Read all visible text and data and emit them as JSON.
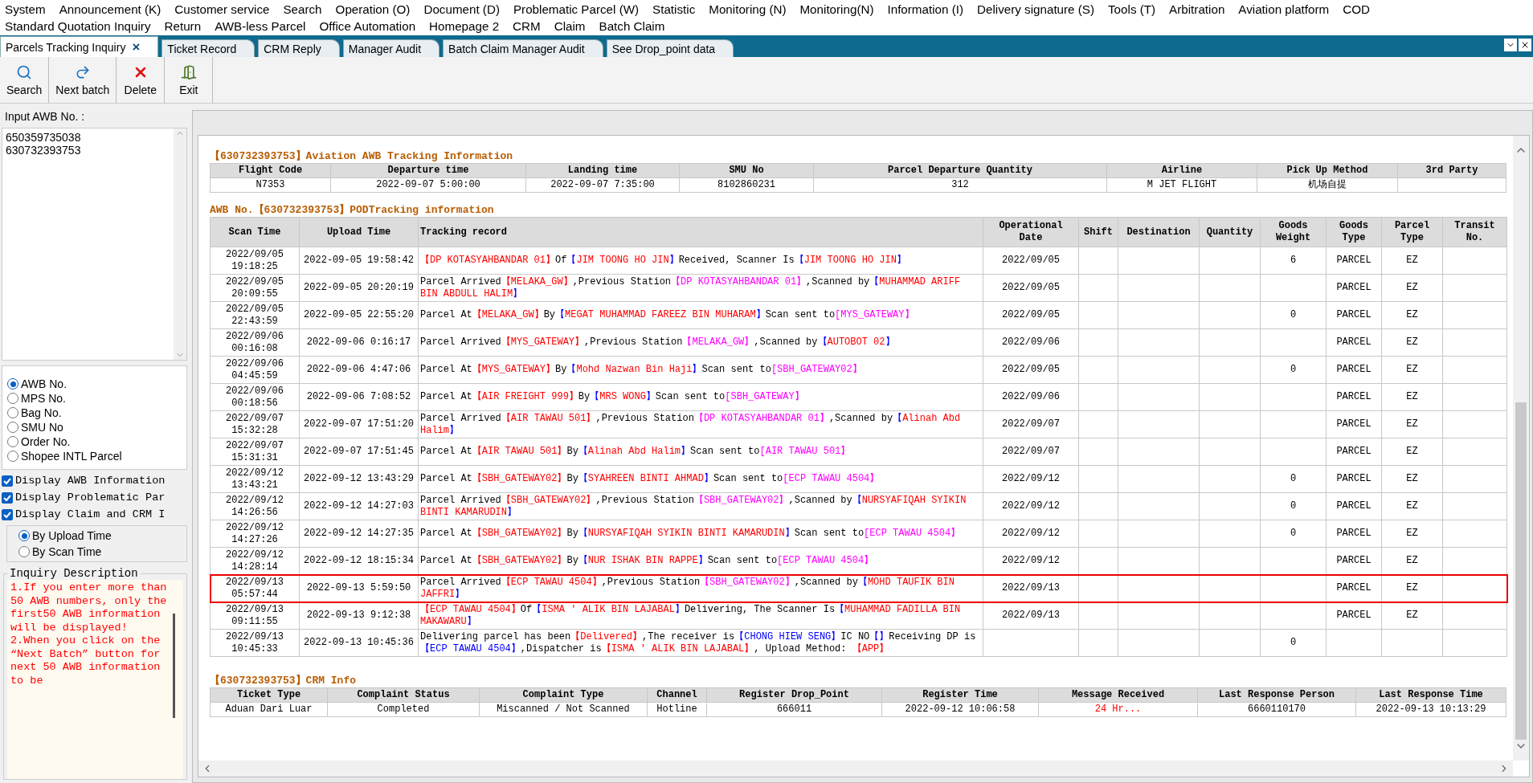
{
  "menu_bar": {
    "items": [
      "System",
      "Announcement (K)",
      "Customer service",
      "Search",
      "Operation (O)",
      "Document (D)",
      "Problematic Parcel (W)",
      "Statistic",
      "Monitoring (N)",
      "Monitoring(N)",
      "Information (I)",
      "Delivery signature (S)",
      "Tools (T)",
      "Arbitration",
      "Aviation platform",
      "COD",
      "Standard Quotation Inquiry",
      "Return",
      "AWB-less Parcel",
      "Office Automation",
      "Homepage 2",
      "CRM",
      "Claim",
      "Batch Claim"
    ]
  },
  "tabs": [
    {
      "label": "Parcels Tracking Inquiry",
      "selected": true,
      "close": "×"
    },
    {
      "label": "Ticket Record",
      "selected": false
    },
    {
      "label": "CRM Reply",
      "selected": false
    },
    {
      "label": "Manager Audit",
      "selected": false
    },
    {
      "label": "Batch Claim Manager Audit",
      "selected": false
    },
    {
      "label": "See Drop_point data",
      "selected": false
    }
  ],
  "toolbar": [
    {
      "label": "Search",
      "kind": "search"
    },
    {
      "label": "Next batch",
      "kind": "next"
    },
    {
      "label": "Delete",
      "kind": "delete"
    },
    {
      "label": "Exit",
      "kind": "exit"
    }
  ],
  "sidebar": {
    "input_label": "Input AWB No. :",
    "awb_numbers": [
      "650359735038",
      "630732393753"
    ],
    "search_types": [
      {
        "label": "AWB No.",
        "selected": true
      },
      {
        "label": "MPS No.",
        "selected": false
      },
      {
        "label": "Bag No.",
        "selected": false
      },
      {
        "label": "SMU No",
        "selected": false
      },
      {
        "label": "Order No.",
        "selected": false
      },
      {
        "label": "Shopee INTL Parcel",
        "selected": false
      }
    ],
    "options": [
      {
        "label": "Display AWB Information",
        "checked": true
      },
      {
        "label": "Display Problematic Par",
        "checked": true
      },
      {
        "label": "Display Claim and CRM I",
        "checked": true
      }
    ],
    "sort": [
      {
        "label": "By Upload Time",
        "selected": true
      },
      {
        "label": "By Scan Time",
        "selected": false
      }
    ],
    "description": {
      "title": "Inquiry Description",
      "paragraphs": [
        "1.If you enter more than  50  AWB numbers, only the first50  AWB information will be displayed!",
        "2.When you click on the “Next Batch” button for next  50 AWB information to be"
      ]
    }
  },
  "aviation": {
    "title": "【630732393753】Aviation AWB Tracking Information",
    "columns": [
      "Flight Code",
      "Departure time",
      "Landing time",
      "SMU No",
      "Parcel Departure Quantity",
      "Airline",
      "Pick Up Method",
      "3rd Party"
    ],
    "rows": [
      [
        "N7353",
        "2022-09-07 5:00:00",
        "2022-09-07 7:35:00",
        "8102860231",
        "312",
        "M JET FLIGHT",
        "机场自提",
        ""
      ]
    ]
  },
  "tracking": {
    "title": "AWB No.【630732393753】PODTracking information",
    "columns": [
      "Scan Time",
      "Upload Time",
      "Tracking record",
      "Operational Date",
      "Shift",
      "Destination",
      "Quantity",
      "Goods Weight",
      "Goods Type",
      "Parcel Type",
      "Transit No."
    ],
    "rows": [
      {
        "selected": false,
        "scan_time": "2022/09/05 19:18:25",
        "upload_time": "2022-09-05 19:58:42",
        "record": [
          {
            "kind": "site",
            "text": "【DP KOTASYAHBANDAR 01】"
          },
          {
            "kind": "text",
            "text": "Of"
          },
          {
            "kind": "person",
            "text": "【JIM TOONG HO JIN】"
          },
          {
            "kind": "text",
            "text": "Received, Scanner Is"
          },
          {
            "kind": "person",
            "text": "【JIM TOONG HO JIN】"
          }
        ],
        "operational_date": "2022/09/05",
        "goods_weight": "6",
        "goods_type": "PARCEL",
        "parcel_type": "EZ"
      },
      {
        "selected": false,
        "scan_time": "2022/09/05 20:09:55",
        "upload_time": "2022-09-05 20:20:19",
        "record": [
          {
            "kind": "text",
            "text": "Parcel Arrived"
          },
          {
            "kind": "site",
            "text": "【MELAKA_GW】"
          },
          {
            "kind": "text",
            "text": ",Previous Station"
          },
          {
            "kind": "next",
            "text": "【DP KOTASYAHBANDAR 01】"
          },
          {
            "kind": "text",
            "text": ",Scanned by"
          },
          {
            "kind": "person",
            "text": "【MUHAMMAD ARIFF BIN ABDULL HALIM】"
          }
        ],
        "operational_date": "2022/09/05",
        "goods_type": "PARCEL",
        "parcel_type": "EZ"
      },
      {
        "selected": false,
        "scan_time": "2022/09/05 22:43:59",
        "upload_time": "2022-09-05 22:55:20",
        "record": [
          {
            "kind": "text",
            "text": "Parcel At"
          },
          {
            "kind": "site",
            "text": "【MELAKA_GW】"
          },
          {
            "kind": "text",
            "text": "By"
          },
          {
            "kind": "person",
            "text": "【MEGAT MUHAMMAD FAREEZ BIN MUHARAM】"
          },
          {
            "kind": "text",
            "text": "Scan sent to"
          },
          {
            "kind": "next",
            "text": "[MYS_GATEWAY】"
          }
        ],
        "operational_date": "2022/09/05",
        "goods_weight": "0",
        "goods_type": "PARCEL",
        "parcel_type": "EZ"
      },
      {
        "selected": false,
        "scan_time": "2022/09/06 00:16:08",
        "upload_time": "2022-09-06 0:16:17",
        "record": [
          {
            "kind": "text",
            "text": "Parcel Arrived"
          },
          {
            "kind": "site",
            "text": "【MYS_GATEWAY】"
          },
          {
            "kind": "text",
            "text": ",Previous Station"
          },
          {
            "kind": "next",
            "text": "【MELAKA_GW】"
          },
          {
            "kind": "text",
            "text": ",Scanned by"
          },
          {
            "kind": "person",
            "text": "【AUTOBOT 02】"
          }
        ],
        "operational_date": "2022/09/06",
        "goods_type": "PARCEL",
        "parcel_type": "EZ"
      },
      {
        "selected": false,
        "scan_time": "2022/09/06 04:45:59",
        "upload_time": "2022-09-06 4:47:06",
        "record": [
          {
            "kind": "text",
            "text": "Parcel At"
          },
          {
            "kind": "site",
            "text": "【MYS_GATEWAY】"
          },
          {
            "kind": "text",
            "text": "By"
          },
          {
            "kind": "person",
            "text": "【Mohd Nazwan Bin Haji】"
          },
          {
            "kind": "text",
            "text": "Scan sent to"
          },
          {
            "kind": "next",
            "text": "[SBH_GATEWAY02】"
          }
        ],
        "operational_date": "2022/09/05",
        "goods_weight": "0",
        "goods_type": "PARCEL",
        "parcel_type": "EZ"
      },
      {
        "selected": false,
        "scan_time": "2022/09/06 00:18:56",
        "upload_time": "2022-09-06 7:08:52",
        "record": [
          {
            "kind": "text",
            "text": "Parcel At"
          },
          {
            "kind": "site",
            "text": "【AIR FREIGHT 999】"
          },
          {
            "kind": "text",
            "text": "By"
          },
          {
            "kind": "person",
            "text": "【MRS WONG】"
          },
          {
            "kind": "text",
            "text": "Scan sent to"
          },
          {
            "kind": "next",
            "text": "[SBH_GATEWAY】"
          }
        ],
        "operational_date": "2022/09/06",
        "goods_type": "PARCEL",
        "parcel_type": "EZ"
      },
      {
        "selected": false,
        "scan_time": "2022/09/07 15:32:28",
        "upload_time": "2022-09-07 17:51:20",
        "record": [
          {
            "kind": "text",
            "text": "Parcel Arrived"
          },
          {
            "kind": "site",
            "text": "【AIR TAWAU 501】"
          },
          {
            "kind": "text",
            "text": ",Previous Station"
          },
          {
            "kind": "next",
            "text": "【DP KOTASYAHBANDAR 01】"
          },
          {
            "kind": "text",
            "text": ",Scanned by"
          },
          {
            "kind": "person",
            "text": "【Alinah Abd Halim】"
          }
        ],
        "operational_date": "2022/09/07",
        "goods_type": "PARCEL",
        "parcel_type": "EZ"
      },
      {
        "selected": false,
        "scan_time": "2022/09/07 15:31:31",
        "upload_time": "2022-09-07 17:51:45",
        "record": [
          {
            "kind": "text",
            "text": "Parcel At"
          },
          {
            "kind": "site",
            "text": "【AIR TAWAU 501】"
          },
          {
            "kind": "text",
            "text": "By"
          },
          {
            "kind": "person",
            "text": "【Alinah Abd Halim】"
          },
          {
            "kind": "text",
            "text": "Scan sent to"
          },
          {
            "kind": "next",
            "text": "[AIR TAWAU 501】"
          }
        ],
        "operational_date": "2022/09/07",
        "goods_type": "PARCEL",
        "parcel_type": "EZ"
      },
      {
        "selected": false,
        "scan_time": "2022/09/12 13:43:21",
        "upload_time": "2022-09-12 13:43:29",
        "record": [
          {
            "kind": "text",
            "text": "Parcel At"
          },
          {
            "kind": "site",
            "text": "【SBH_GATEWAY02】"
          },
          {
            "kind": "text",
            "text": "By"
          },
          {
            "kind": "person",
            "text": "【SYAHREEN BINTI AHMAD】"
          },
          {
            "kind": "text",
            "text": "Scan sent to"
          },
          {
            "kind": "next",
            "text": "[ECP TAWAU 4504】"
          }
        ],
        "operational_date": "2022/09/12",
        "goods_weight": "0",
        "goods_type": "PARCEL",
        "parcel_type": "EZ"
      },
      {
        "selected": false,
        "scan_time": "2022/09/12 14:26:56",
        "upload_time": "2022-09-12 14:27:03",
        "record": [
          {
            "kind": "text",
            "text": "Parcel Arrived"
          },
          {
            "kind": "site",
            "text": "【SBH_GATEWAY02】"
          },
          {
            "kind": "text",
            "text": ",Previous Station"
          },
          {
            "kind": "next",
            "text": "【SBH_GATEWAY02】"
          },
          {
            "kind": "text",
            "text": ",Scanned by"
          },
          {
            "kind": "person",
            "text": "【NURSYAFIQAH SYIKIN BINTI KAMARUDIN】"
          }
        ],
        "operational_date": "2022/09/12",
        "goods_weight": "0",
        "goods_type": "PARCEL",
        "parcel_type": "EZ"
      },
      {
        "selected": false,
        "scan_time": "2022/09/12 14:27:26",
        "upload_time": "2022-09-12 14:27:35",
        "record": [
          {
            "kind": "text",
            "text": "Parcel At"
          },
          {
            "kind": "site",
            "text": "【SBH_GATEWAY02】"
          },
          {
            "kind": "text",
            "text": "By"
          },
          {
            "kind": "person",
            "text": "【NURSYAFIQAH SYIKIN BINTI KAMARUDIN】"
          },
          {
            "kind": "text",
            "text": "Scan sent to"
          },
          {
            "kind": "next",
            "text": "[ECP TAWAU 4504】"
          }
        ],
        "operational_date": "2022/09/12",
        "goods_weight": "0",
        "goods_type": "PARCEL",
        "parcel_type": "EZ"
      },
      {
        "selected": false,
        "scan_time": "2022/09/12 14:28:14",
        "upload_time": "2022-09-12 18:15:34",
        "record": [
          {
            "kind": "text",
            "text": "Parcel At"
          },
          {
            "kind": "site",
            "text": "【SBH_GATEWAY02】"
          },
          {
            "kind": "text",
            "text": "By"
          },
          {
            "kind": "person",
            "text": "【NUR ISHAK BIN RAPPE】"
          },
          {
            "kind": "text",
            "text": "Scan sent to"
          },
          {
            "kind": "next",
            "text": "[ECP TAWAU 4504】"
          }
        ],
        "operational_date": "2022/09/12",
        "goods_type": "PARCEL",
        "parcel_type": "EZ"
      },
      {
        "selected": true,
        "scan_time": "2022/09/13 05:57:44",
        "upload_time": "2022-09-13 5:59:50",
        "record": [
          {
            "kind": "text",
            "text": "Parcel Arrived"
          },
          {
            "kind": "site",
            "text": "【ECP TAWAU 4504】"
          },
          {
            "kind": "text",
            "text": ",Previous Station"
          },
          {
            "kind": "next",
            "text": "【SBH_GATEWAY02】"
          },
          {
            "kind": "text",
            "text": ",Scanned by"
          },
          {
            "kind": "person",
            "text": "【MOHD TAUFIK BIN JAFFRI】"
          }
        ],
        "operational_date": "2022/09/13",
        "goods_type": "PARCEL",
        "parcel_type": "EZ"
      },
      {
        "selected": false,
        "scan_time": "2022/09/13 09:11:55",
        "upload_time": "2022-09-13 9:12:38",
        "record": [
          {
            "kind": "site",
            "text": "【ECP TAWAU 4504】"
          },
          {
            "kind": "text",
            "text": "Of"
          },
          {
            "kind": "person",
            "text": "【ISMA ′ ALIK BIN LAJABAL】"
          },
          {
            "kind": "text",
            "text": "Delivering, The Scanner Is"
          },
          {
            "kind": "person",
            "text": "【MUHAMMAD FADILLA BIN MAKAWARU】"
          }
        ],
        "operational_date": "2022/09/13",
        "goods_type": "PARCEL",
        "parcel_type": "EZ"
      },
      {
        "selected": false,
        "scan_time": "2022/09/13 10:45:33",
        "upload_time": "2022-09-13 10:45:36",
        "record": [
          {
            "kind": "text",
            "text": "Delivering parcel has been"
          },
          {
            "kind": "site",
            "text": "【Delivered】"
          },
          {
            "kind": "text",
            "text": ",The receiver is"
          },
          {
            "kind": "info",
            "text": "【CHONG HIEW SENG】"
          },
          {
            "kind": "text",
            "text": "IC NO"
          },
          {
            "kind": "info",
            "text": "【】"
          },
          {
            "kind": "text",
            "text": "Receiving DP is"
          },
          {
            "kind": "info",
            "text": "【ECP TAWAU 4504】"
          },
          {
            "kind": "text",
            "text": ",Dispatcher is"
          },
          {
            "kind": "site",
            "text": "【ISMA ′ ALIK BIN LAJABAL】"
          },
          {
            "kind": "text",
            "text": ", Upload Method: "
          },
          {
            "kind": "site",
            "text": "【APP】"
          }
        ],
        "goods_weight": "0"
      }
    ]
  },
  "crm": {
    "title": "【630732393753】CRM Info",
    "columns": [
      "Ticket Type",
      "Complaint Status",
      "Complaint Type",
      "Channel",
      "Register Drop_Point",
      "Register Time",
      "Message Received",
      "Last Response Person",
      "Last Response Time"
    ],
    "rows": [
      [
        {
          "text": "Aduan Dari Luar",
          "alert": false
        },
        {
          "text": "Completed",
          "alert": false
        },
        {
          "text": "Miscanned / Not Scanned",
          "alert": false
        },
        {
          "text": "Hotline",
          "alert": false
        },
        {
          "text": "666011",
          "alert": false
        },
        {
          "text": "2022-09-12 10:06:58",
          "alert": false
        },
        {
          "text": "24 Hr...",
          "alert": true
        },
        {
          "text": "6660110170",
          "alert": false
        },
        {
          "text": "2022-09-13 10:13:29",
          "alert": false
        }
      ]
    ]
  }
}
